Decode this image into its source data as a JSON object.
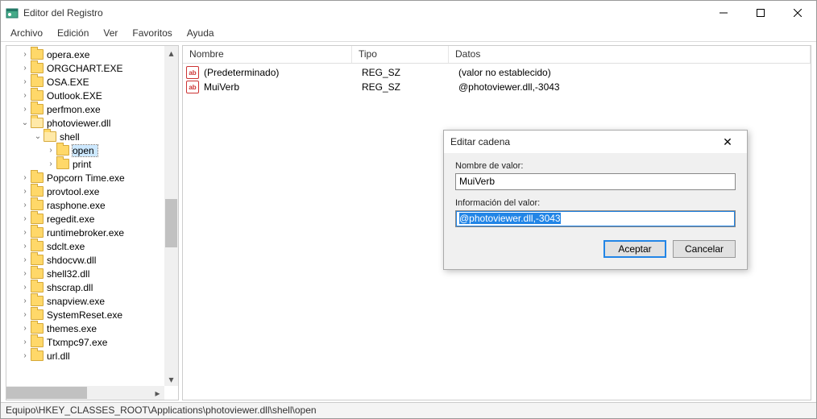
{
  "window": {
    "title": "Editor del Registro"
  },
  "menu": {
    "file": "Archivo",
    "edit": "Edición",
    "view": "Ver",
    "favorites": "Favoritos",
    "help": "Ayuda"
  },
  "tree": {
    "items": [
      {
        "depth": 1,
        "caret": ">",
        "label": "opera.exe"
      },
      {
        "depth": 1,
        "caret": ">",
        "label": "ORGCHART.EXE"
      },
      {
        "depth": 1,
        "caret": ">",
        "label": "OSA.EXE"
      },
      {
        "depth": 1,
        "caret": ">",
        "label": "Outlook.EXE"
      },
      {
        "depth": 1,
        "caret": ">",
        "label": "perfmon.exe"
      },
      {
        "depth": 1,
        "caret": "v",
        "label": "photoviewer.dll",
        "open": true
      },
      {
        "depth": 2,
        "caret": "v",
        "label": "shell",
        "open": true
      },
      {
        "depth": 3,
        "caret": ">",
        "label": "open",
        "selected": true
      },
      {
        "depth": 3,
        "caret": ">",
        "label": "print"
      },
      {
        "depth": 1,
        "caret": ">",
        "label": "Popcorn Time.exe"
      },
      {
        "depth": 1,
        "caret": ">",
        "label": "provtool.exe"
      },
      {
        "depth": 1,
        "caret": ">",
        "label": "rasphone.exe"
      },
      {
        "depth": 1,
        "caret": ">",
        "label": "regedit.exe"
      },
      {
        "depth": 1,
        "caret": ">",
        "label": "runtimebroker.exe"
      },
      {
        "depth": 1,
        "caret": ">",
        "label": "sdclt.exe"
      },
      {
        "depth": 1,
        "caret": ">",
        "label": "shdocvw.dll"
      },
      {
        "depth": 1,
        "caret": ">",
        "label": "shell32.dll"
      },
      {
        "depth": 1,
        "caret": ">",
        "label": "shscrap.dll"
      },
      {
        "depth": 1,
        "caret": ">",
        "label": "snapview.exe"
      },
      {
        "depth": 1,
        "caret": ">",
        "label": "SystemReset.exe"
      },
      {
        "depth": 1,
        "caret": ">",
        "label": "themes.exe"
      },
      {
        "depth": 1,
        "caret": ">",
        "label": "Ttxmpc97.exe"
      },
      {
        "depth": 1,
        "caret": ">",
        "label": "url.dll"
      }
    ]
  },
  "list": {
    "headers": {
      "name": "Nombre",
      "type": "Tipo",
      "data": "Datos"
    },
    "rows": [
      {
        "name": "(Predeterminado)",
        "type": "REG_SZ",
        "data": "(valor no establecido)"
      },
      {
        "name": "MuiVerb",
        "type": "REG_SZ",
        "data": "@photoviewer.dll,-3043"
      }
    ]
  },
  "status": {
    "path": "Equipo\\HKEY_CLASSES_ROOT\\Applications\\photoviewer.dll\\shell\\open"
  },
  "dialog": {
    "title": "Editar cadena",
    "name_label": "Nombre de valor:",
    "name_value": "MuiVerb",
    "data_label": "Información del valor:",
    "data_value": "@photoviewer.dll,-3043",
    "ok": "Aceptar",
    "cancel": "Cancelar"
  }
}
